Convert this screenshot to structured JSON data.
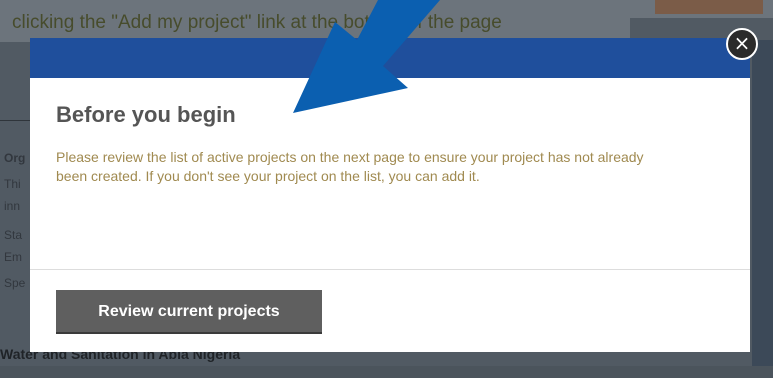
{
  "background": {
    "heading_fragment": "clicking the \"Add my project\" link at the bottom of the page",
    "side_fragments": [
      "Org",
      "Thi",
      "inn",
      "Sta",
      "Em",
      "Spe"
    ],
    "bottom_title": "Water and Sanitation in Abia Nigeria"
  },
  "modal": {
    "title": "Before you begin",
    "body": "Please review the list of active projects on the next page to ensure your project has not already been created. If you don't see your project on the list, you can add it.",
    "primary_button": "Review current projects",
    "close_icon": "×"
  },
  "colors": {
    "header": "#1f4f9c",
    "arrow": "#0b5fb0",
    "button": "#5f5f5f",
    "body_text": "#a08a50"
  }
}
